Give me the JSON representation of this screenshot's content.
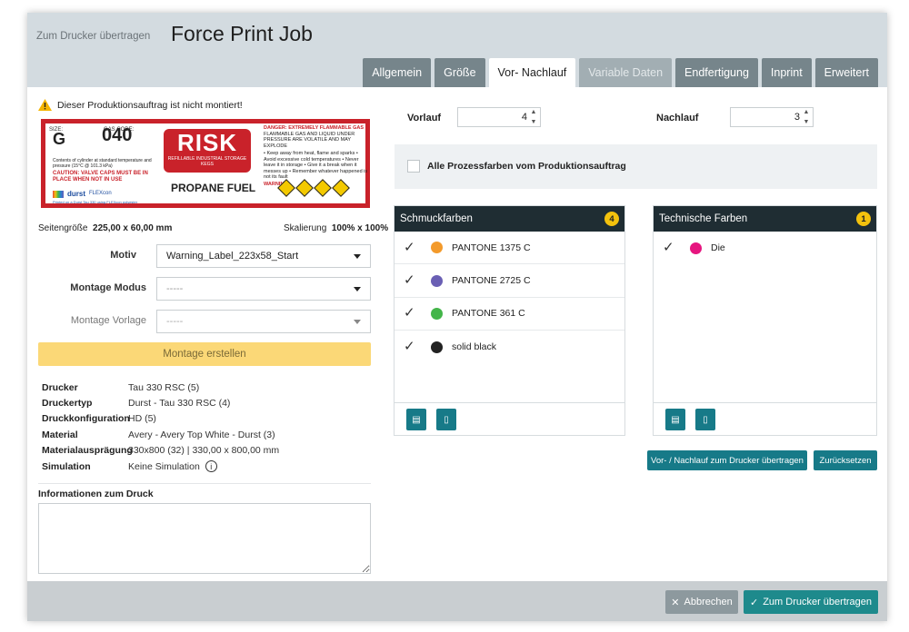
{
  "header": {
    "breadcrumb": "Zum Drucker übertragen",
    "title": "Force Print Job",
    "tabs": [
      {
        "label": "Allgemein",
        "state": "normal"
      },
      {
        "label": "Größe",
        "state": "normal"
      },
      {
        "label": "Vor- Nachlauf",
        "state": "active"
      },
      {
        "label": "Variable Daten",
        "state": "disabled"
      },
      {
        "label": "Endfertigung",
        "state": "normal"
      },
      {
        "label": "Inprint",
        "state": "normal"
      },
      {
        "label": "Erweitert",
        "state": "normal"
      }
    ]
  },
  "left": {
    "warning": "Dieser Produktionsauftrag ist nicht montiert!",
    "preview": {
      "size_label": "SIZE:",
      "size_value": "G",
      "gas_code_label": "GAS CODE:",
      "gas_code_value": "040",
      "contents": "Contents of cylinder at standard temperature and pressure (15°C @ 101.3 kPa)",
      "caution": "CAUTION: VALVE CAPS MUST BE IN PLACE WHEN NOT IN USE",
      "logo_durst": "durst",
      "logo_flexcon": "FLEXcon",
      "printed_on": "Printed on a Durst Tau 330 using FLEXcon polyester",
      "risk": "RISK",
      "risk_sub": "REFILLABLE INDUSTRIAL STORAGE KEGS",
      "propane": "PROPANE FUEL",
      "danger": "DANGER: EXTREMELY FLAMMABLE GAS",
      "danger_sub": "FLAMMABLE GAS AND LIQUID UNDER PRESSURE ARE VOLATILE AND MAY EXPLODE",
      "bullets": "• Keep away from heat, flame and sparks • Avoid excessive cold temperatures • Never leave it in storage • Give it a break when it messes up • Remember whatever happened is not its fault",
      "warning_label": "WARNING:"
    },
    "page_size_label": "Seitengröße",
    "page_size_value": "225,00 x 60,00 mm",
    "scale_label": "Skalierung",
    "scale_value": "100% x 100%",
    "motiv_label": "Motiv",
    "motiv_value": "Warning_Label_223x58_Start",
    "montage_modus_label": "Montage Modus",
    "montage_modus_value": "-----",
    "montage_vorlage_label": "Montage Vorlage",
    "montage_vorlage_value": "-----",
    "montage_button": "Montage erstellen",
    "info_rows": [
      {
        "key": "Drucker",
        "value": "Tau 330 RSC (5)"
      },
      {
        "key": "Druckertyp",
        "value": "Durst - Tau 330 RSC (4)"
      },
      {
        "key": "Druckkonfiguration",
        "value": "HD (5)"
      },
      {
        "key": "Material",
        "value": "Avery - Avery Top White - Durst (3)"
      },
      {
        "key": "Materialausprägung",
        "value": "330x800 (32) | 330,00 x 800,00 mm"
      },
      {
        "key": "Simulation",
        "value": "Keine Simulation"
      }
    ],
    "notes_label": "Informationen zum Druck",
    "notes_value": ""
  },
  "right": {
    "vorlauf_label": "Vorlauf",
    "vorlauf_value": "4",
    "nachlauf_label": "Nachlauf",
    "nachlauf_value": "3",
    "all_process_label": "Alle Prozessfarben vom Produktionsauftrag",
    "spot_panel": {
      "title": "Schmuckfarben",
      "count": "4",
      "colors": [
        {
          "name": "PANTONE 1375 C",
          "color": "#f39a2b",
          "checked": true
        },
        {
          "name": "PANTONE 2725 C",
          "color": "#6a5fb4",
          "checked": true
        },
        {
          "name": "PANTONE 361 C",
          "color": "#43b549",
          "checked": true
        },
        {
          "name": "solid black",
          "color": "#222222",
          "checked": true
        }
      ]
    },
    "tech_panel": {
      "title": "Technische Farben",
      "count": "1",
      "colors": [
        {
          "name": "Die",
          "color": "#e6157f",
          "checked": true
        }
      ]
    },
    "transfer_button": "Vor- / Nachlauf zum Drucker übertragen",
    "reset_button": "Zurücksetzen"
  },
  "footer": {
    "cancel_button": "Abbrechen",
    "submit_button": "Zum Drucker übertragen"
  }
}
